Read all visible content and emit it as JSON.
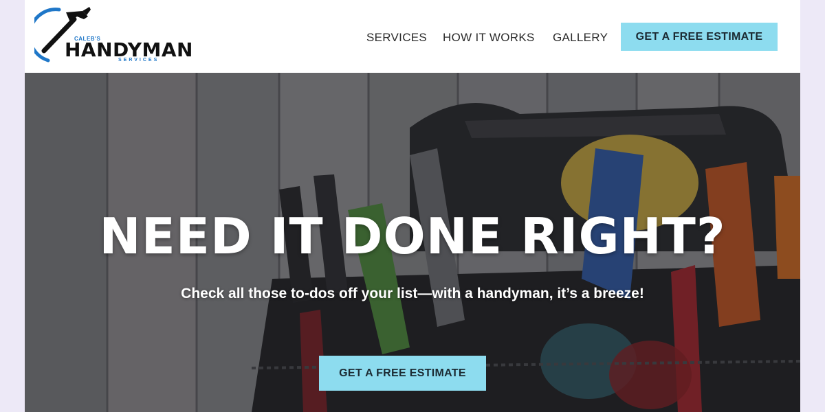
{
  "logo": {
    "small_text": "CALEB'S",
    "main_text": "HANDYMAN",
    "sub_text": "SERVICES",
    "icon": "hammer-icon"
  },
  "nav": {
    "items": [
      {
        "label": "SERVICES"
      },
      {
        "label": "HOW IT WORKS"
      },
      {
        "label": "GALLERY"
      }
    ],
    "cta_label": "GET A FREE ESTIMATE"
  },
  "hero": {
    "title": "NEED IT DONE RIGHT?",
    "subtitle": "Check all those to-dos off your list—with a handyman, it’s a breeze!",
    "cta_label": "GET A FREE ESTIMATE",
    "background": "tool-bag-photo"
  },
  "colors": {
    "accent": "#8ddcef",
    "logo_blue": "#1f77c8",
    "page_margin": "#ede9f7"
  }
}
